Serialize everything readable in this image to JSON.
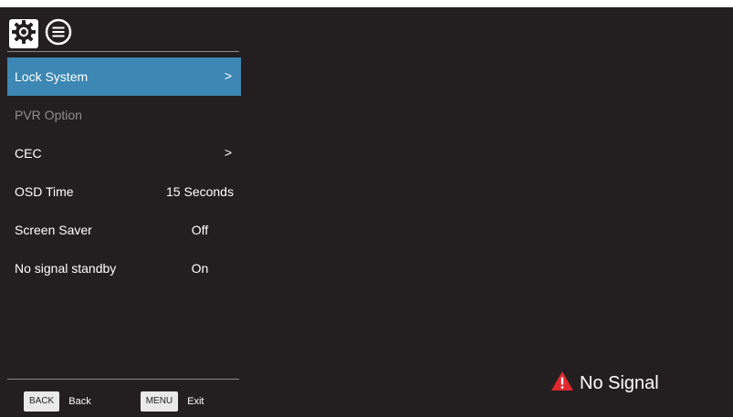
{
  "header": {
    "icons": [
      {
        "name": "settings-gear-icon",
        "active": true
      },
      {
        "name": "list-menu-icon",
        "active": false
      }
    ]
  },
  "menu": {
    "items": [
      {
        "label": "Lock System",
        "value": "",
        "chevron": ">",
        "selected": true
      },
      {
        "label": "PVR Option",
        "value": "",
        "chevron": "",
        "disabled": true
      },
      {
        "label": "CEC",
        "value": "",
        "chevron": ">"
      },
      {
        "label": "OSD Time",
        "value": "15 Seconds",
        "chevron": ""
      },
      {
        "label": "Screen Saver",
        "value": "Off",
        "chevron": ""
      },
      {
        "label": "No signal standby",
        "value": "On",
        "chevron": ""
      }
    ]
  },
  "footer": {
    "back_key": "BACK",
    "back_label": "Back",
    "menu_key": "MENU",
    "menu_label": "Exit"
  },
  "status": {
    "message": "No Signal",
    "icon": "warning-triangle-icon"
  },
  "colors": {
    "background": "#231f20",
    "selected": "#3c87b3",
    "warning": "#e0282e",
    "disabled_text": "#8e8e8e"
  }
}
